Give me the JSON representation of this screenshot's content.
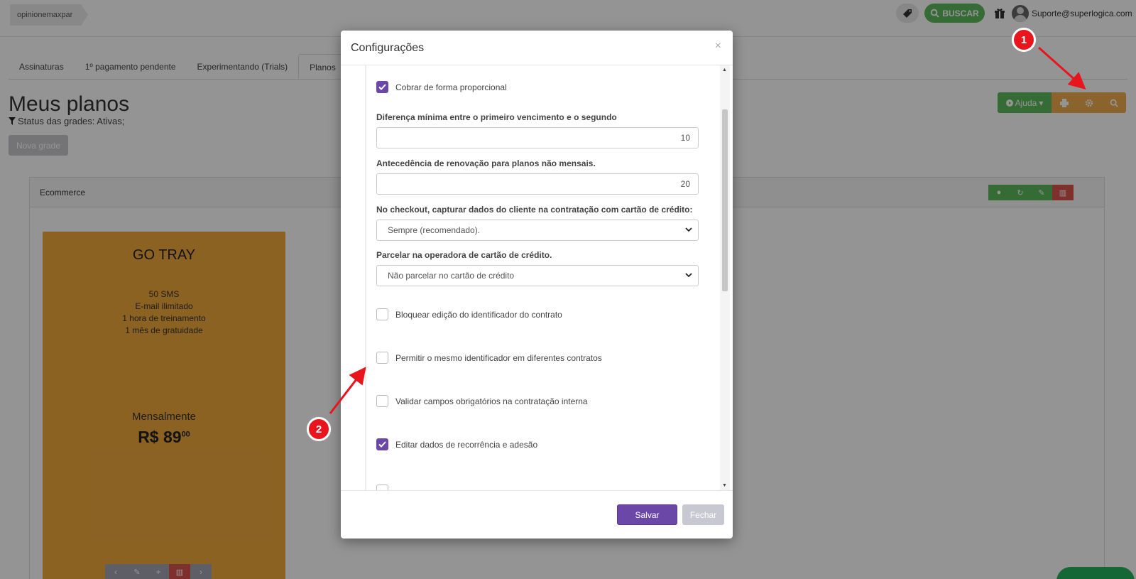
{
  "topbar": {
    "breadcrumb": "opinionemaxpar",
    "buscar_label": "BUSCAR",
    "user_email": "Suporte@superlogica.com"
  },
  "tabs": [
    {
      "label": "Assinaturas"
    },
    {
      "label": "1º pagamento pendente"
    },
    {
      "label": "Experimentando (Trials)"
    },
    {
      "label": "Planos"
    }
  ],
  "page": {
    "title": "Meus planos",
    "status_filter": "Status das grades: Ativas;",
    "new_grade_button": "Nova grade",
    "help_button": "Ajuda"
  },
  "panel": {
    "title": "Ecommerce"
  },
  "plan_card": {
    "name": "GO TRAY",
    "features": [
      "50 SMS",
      "E-mail ilimitado",
      "1 hora de treinamento",
      "1 mês de gratuidade"
    ],
    "period": "Mensalmente",
    "price": "R$ 89",
    "price_cents": "00",
    "color": "#f0a93c"
  },
  "modal": {
    "title": "Configurações",
    "close_symbol": "×",
    "checkboxes": [
      {
        "label": "Cobrar de forma proporcional",
        "checked": true
      },
      {
        "label": "Bloquear edição do identificador do contrato",
        "checked": false
      },
      {
        "label": "Permitir o mesmo identificador em diferentes contratos",
        "checked": false
      },
      {
        "label": "Validar campos obrigatórios na contratação interna",
        "checked": false
      },
      {
        "label": "Editar dados de recorrência e adesão",
        "checked": true
      }
    ],
    "fields": [
      {
        "label": "Diferença mínima entre o primeiro vencimento e o segundo",
        "value": "10"
      },
      {
        "label": "Antecedência de renovação para planos não mensais.",
        "value": "20"
      }
    ],
    "selects": [
      {
        "label": "No checkout, capturar dados do cliente na contratação com cartão de crédito:",
        "value": "Sempre (recomendado)."
      },
      {
        "label": "Parcelar na operadora de cartão de crédito.",
        "value": "Não parcelar no cartão de crédito"
      }
    ],
    "save_button": "Salvar",
    "close_button": "Fechar",
    "accent_color": "#6b47a8"
  },
  "annotations": [
    {
      "number": "1"
    },
    {
      "number": "2"
    }
  ]
}
